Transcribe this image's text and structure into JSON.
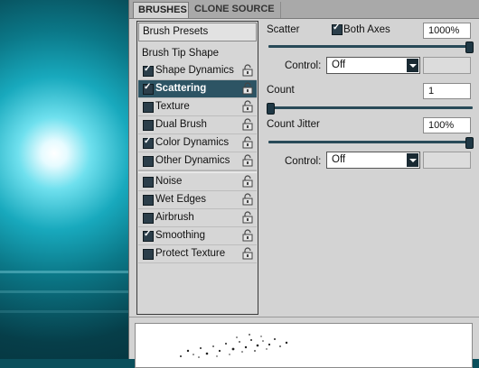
{
  "tabs": {
    "brushes": "BRUSHES",
    "clone_source": "CLONE SOURCE"
  },
  "list": {
    "presets_button": "Brush Presets",
    "tip_shape": "Brush Tip Shape",
    "items": [
      {
        "label": "Shape Dynamics",
        "checked": true
      },
      {
        "label": "Scattering",
        "checked": true,
        "selected": true
      },
      {
        "label": "Texture",
        "checked": false
      },
      {
        "label": "Dual Brush",
        "checked": false
      },
      {
        "label": "Color Dynamics",
        "checked": true
      },
      {
        "label": "Other Dynamics",
        "checked": false
      },
      {
        "label": "Noise",
        "checked": false
      },
      {
        "label": "Wet Edges",
        "checked": false
      },
      {
        "label": "Airbrush",
        "checked": false
      },
      {
        "label": "Smoothing",
        "checked": true
      },
      {
        "label": "Protect Texture",
        "checked": false
      }
    ]
  },
  "scatter": {
    "label": "Scatter",
    "both_axes_label": "Both Axes",
    "both_axes_checked": true,
    "value": "1000%",
    "control_label": "Control:",
    "control_value": "Off"
  },
  "count": {
    "label": "Count",
    "value": "1"
  },
  "count_jitter": {
    "label": "Count Jitter",
    "value": "100%",
    "control_label": "Control:",
    "control_value": "Off"
  },
  "colors": {
    "accent": "#2d5464",
    "panel": "#d3d3d3"
  },
  "icons": {
    "lock": "lock-icon",
    "dropdown": "chevron-down-icon"
  }
}
